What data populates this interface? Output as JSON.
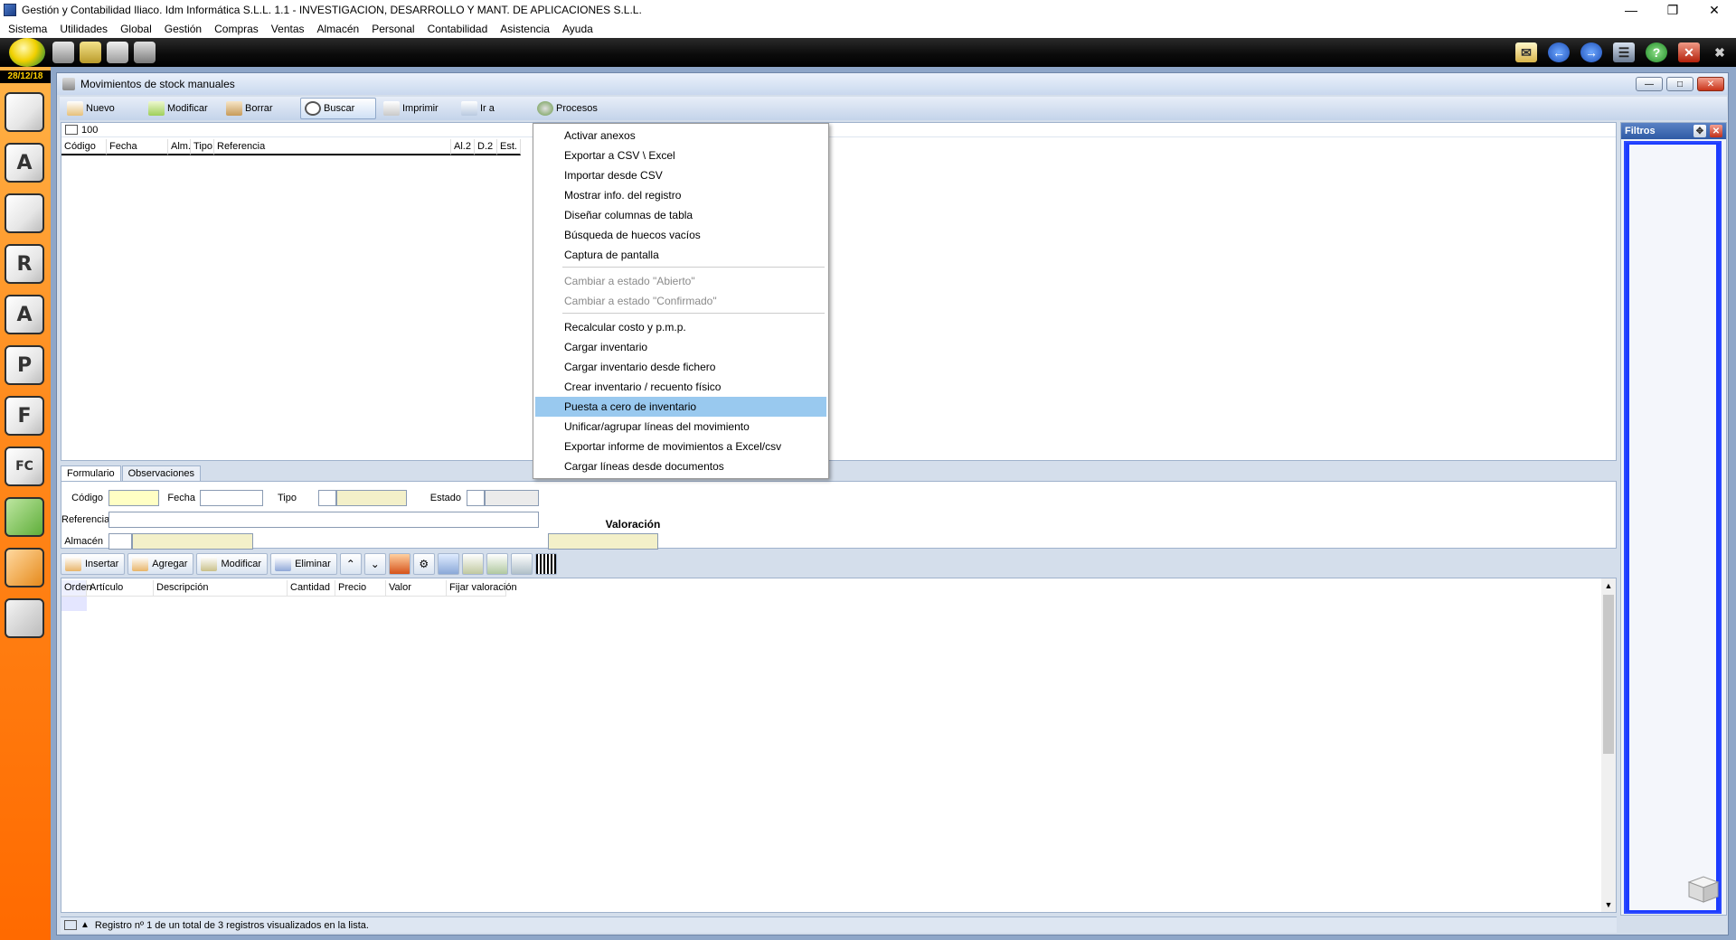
{
  "window_title": "Gestión y Contabilidad Iliaco. Idm Informática S.L.L. 1.1 - INVESTIGACION, DESARROLLO Y MANT. DE APLICACIONES S.L.L.",
  "menu": [
    "Sistema",
    "Utilidades",
    "Global",
    "Gestión",
    "Compras",
    "Ventas",
    "Almacén",
    "Personal",
    "Contabilidad",
    "Asistencia",
    "Ayuda"
  ],
  "date": "28/12/18",
  "sidebar_letters": [
    "",
    "A",
    "",
    "R",
    "A",
    "P",
    "F",
    "FC",
    "",
    "",
    ""
  ],
  "child_window": {
    "title": "Movimientos de stock manuales",
    "toolbar": [
      "Nuevo",
      "Modificar",
      "Borrar",
      "Buscar",
      "Imprimir",
      "Ir a",
      "Procesos"
    ]
  },
  "grid": {
    "count": "100",
    "columns": [
      "Código",
      "Fecha",
      "Alm.",
      "Tipo",
      "Referencia",
      "Al.2",
      "D.2",
      "Est."
    ]
  },
  "filters": {
    "title": "Filtros"
  },
  "tabs": [
    "Formulario",
    "Observaciones"
  ],
  "form": {
    "codigo": "Código",
    "fecha": "Fecha",
    "tipo": "Tipo",
    "estado": "Estado",
    "referencia": "Referencia",
    "almacen": "Almacén",
    "valoracion": "Valoración"
  },
  "line_toolbar": [
    "Insertar",
    "Agregar",
    "Modificar",
    "Eliminar"
  ],
  "lines": {
    "columns": [
      "Orden",
      "Artículo",
      "Descripción",
      "Cantidad",
      "Precio",
      "Valor",
      "Fijar valoración"
    ]
  },
  "status": "Registro nº 1 de un total de 3 registros visualizados en la lista.",
  "popup_menu": {
    "group1": [
      "Activar anexos",
      "Exportar a CSV \\ Excel",
      "Importar desde CSV",
      "Mostrar info. del registro",
      "Diseñar columnas de tabla",
      "Búsqueda de huecos vacíos",
      "Captura de pantalla"
    ],
    "group2": [
      "Cambiar a estado \"Abierto\"",
      "Cambiar a estado \"Confirmado\""
    ],
    "group3": [
      "Recalcular costo y p.m.p.",
      "Cargar inventario",
      "Cargar inventario desde fichero",
      "Crear inventario / recuento físico",
      "Puesta a cero de inventario",
      "Unificar/agrupar líneas del movimiento",
      "Exportar informe de movimientos a Excel/csv",
      "Cargar líneas desde documentos"
    ],
    "highlighted": "Puesta a cero de inventario"
  },
  "colors": {
    "sidebar": "#ff8a1c",
    "highlight": "#99c9ef",
    "date_text": "#ffd000"
  }
}
